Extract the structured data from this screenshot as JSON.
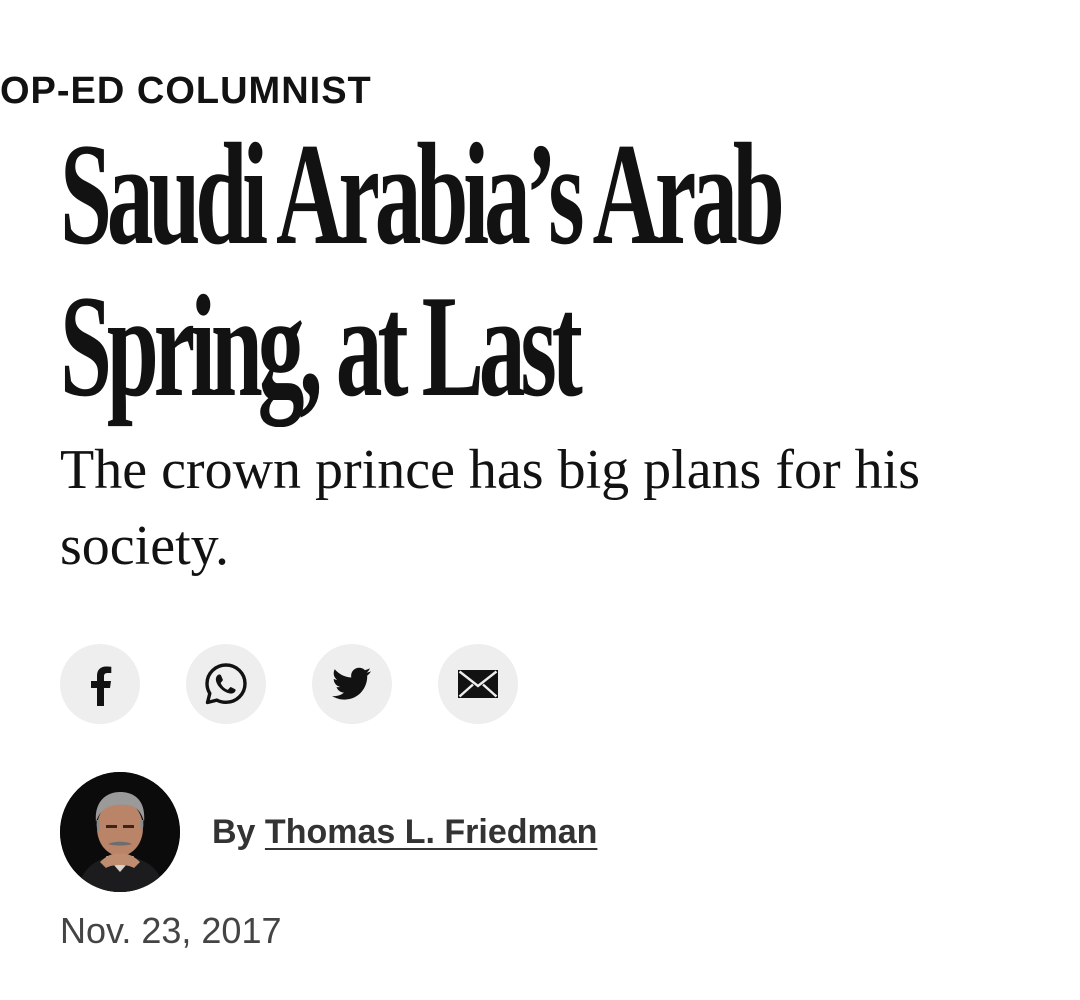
{
  "kicker": "OP-ED COLUMNIST",
  "headline": {
    "line1": "Saudi Arabia’s Arab",
    "line2": "Spring, at Last"
  },
  "summary": "The crown prince has big plans for his society.",
  "share": {
    "buttons": [
      {
        "name": "facebook",
        "icon": "facebook-icon"
      },
      {
        "name": "whatsapp",
        "icon": "whatsapp-icon"
      },
      {
        "name": "twitter",
        "icon": "twitter-icon"
      },
      {
        "name": "email",
        "icon": "email-icon"
      }
    ],
    "background_color": "#eeeeee"
  },
  "byline": {
    "prefix": "By",
    "author": "Thomas L. Friedman"
  },
  "date": "Nov. 23, 2017"
}
